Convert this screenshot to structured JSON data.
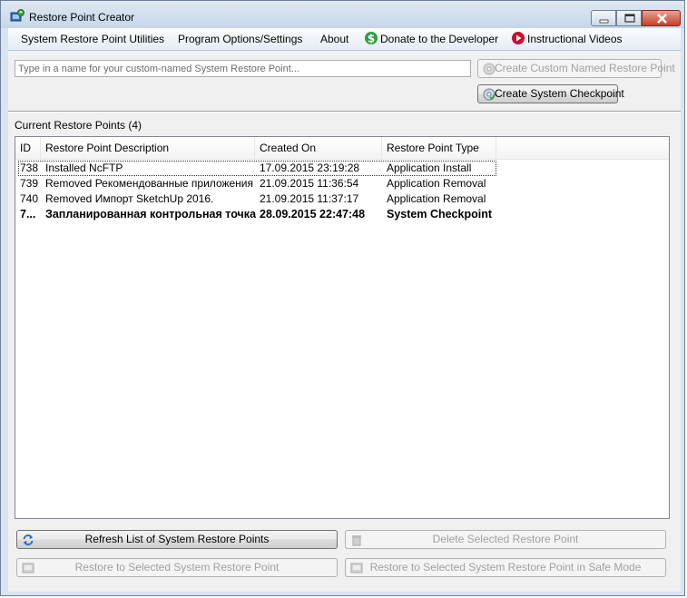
{
  "window": {
    "title": "Restore Point Creator"
  },
  "menu": {
    "utilities": "System Restore Point Utilities",
    "options": "Program Options/Settings",
    "about": "About",
    "donate": "Donate to the Developer",
    "videos": "Instructional Videos"
  },
  "top_panel": {
    "name_input": {
      "value": "",
      "placeholder": "Type in a name for your custom-named System Restore Point..."
    },
    "create_custom_label": "Create Custom Named Restore Point",
    "create_checkpoint_label": "Create System Checkpoint"
  },
  "list": {
    "title": "Current Restore Points (4)",
    "columns": [
      "ID",
      "Restore Point Description",
      "Created On",
      "Restore Point Type"
    ],
    "rows": [
      {
        "id": "738",
        "description": "Installed NcFTP",
        "created": "17.09.2015 23:19:28",
        "type": "Application Install"
      },
      {
        "id": "739",
        "description": "Removed Рекомендованные приложения ...",
        "created": "21.09.2015 11:36:54",
        "type": "Application Removal"
      },
      {
        "id": "740",
        "description": "Removed Импорт SketchUp 2016.",
        "created": "21.09.2015 11:37:17",
        "type": "Application Removal"
      },
      {
        "id": "7...",
        "description": "Запланированная контрольная точка",
        "created": "28.09.2015 22:47:48",
        "type": "System Checkpoint"
      }
    ]
  },
  "actions": {
    "refresh": "Refresh List of System Restore Points",
    "delete": "Delete Selected Restore Point",
    "restore": "Restore to Selected System Restore Point",
    "restore_safe": "Restore to Selected System Restore Point in Safe Mode"
  },
  "colors": {
    "donate_icon": "#2e9e3a",
    "video_icon": "#c8102e",
    "refresh_icon": "#2d6fc4"
  }
}
